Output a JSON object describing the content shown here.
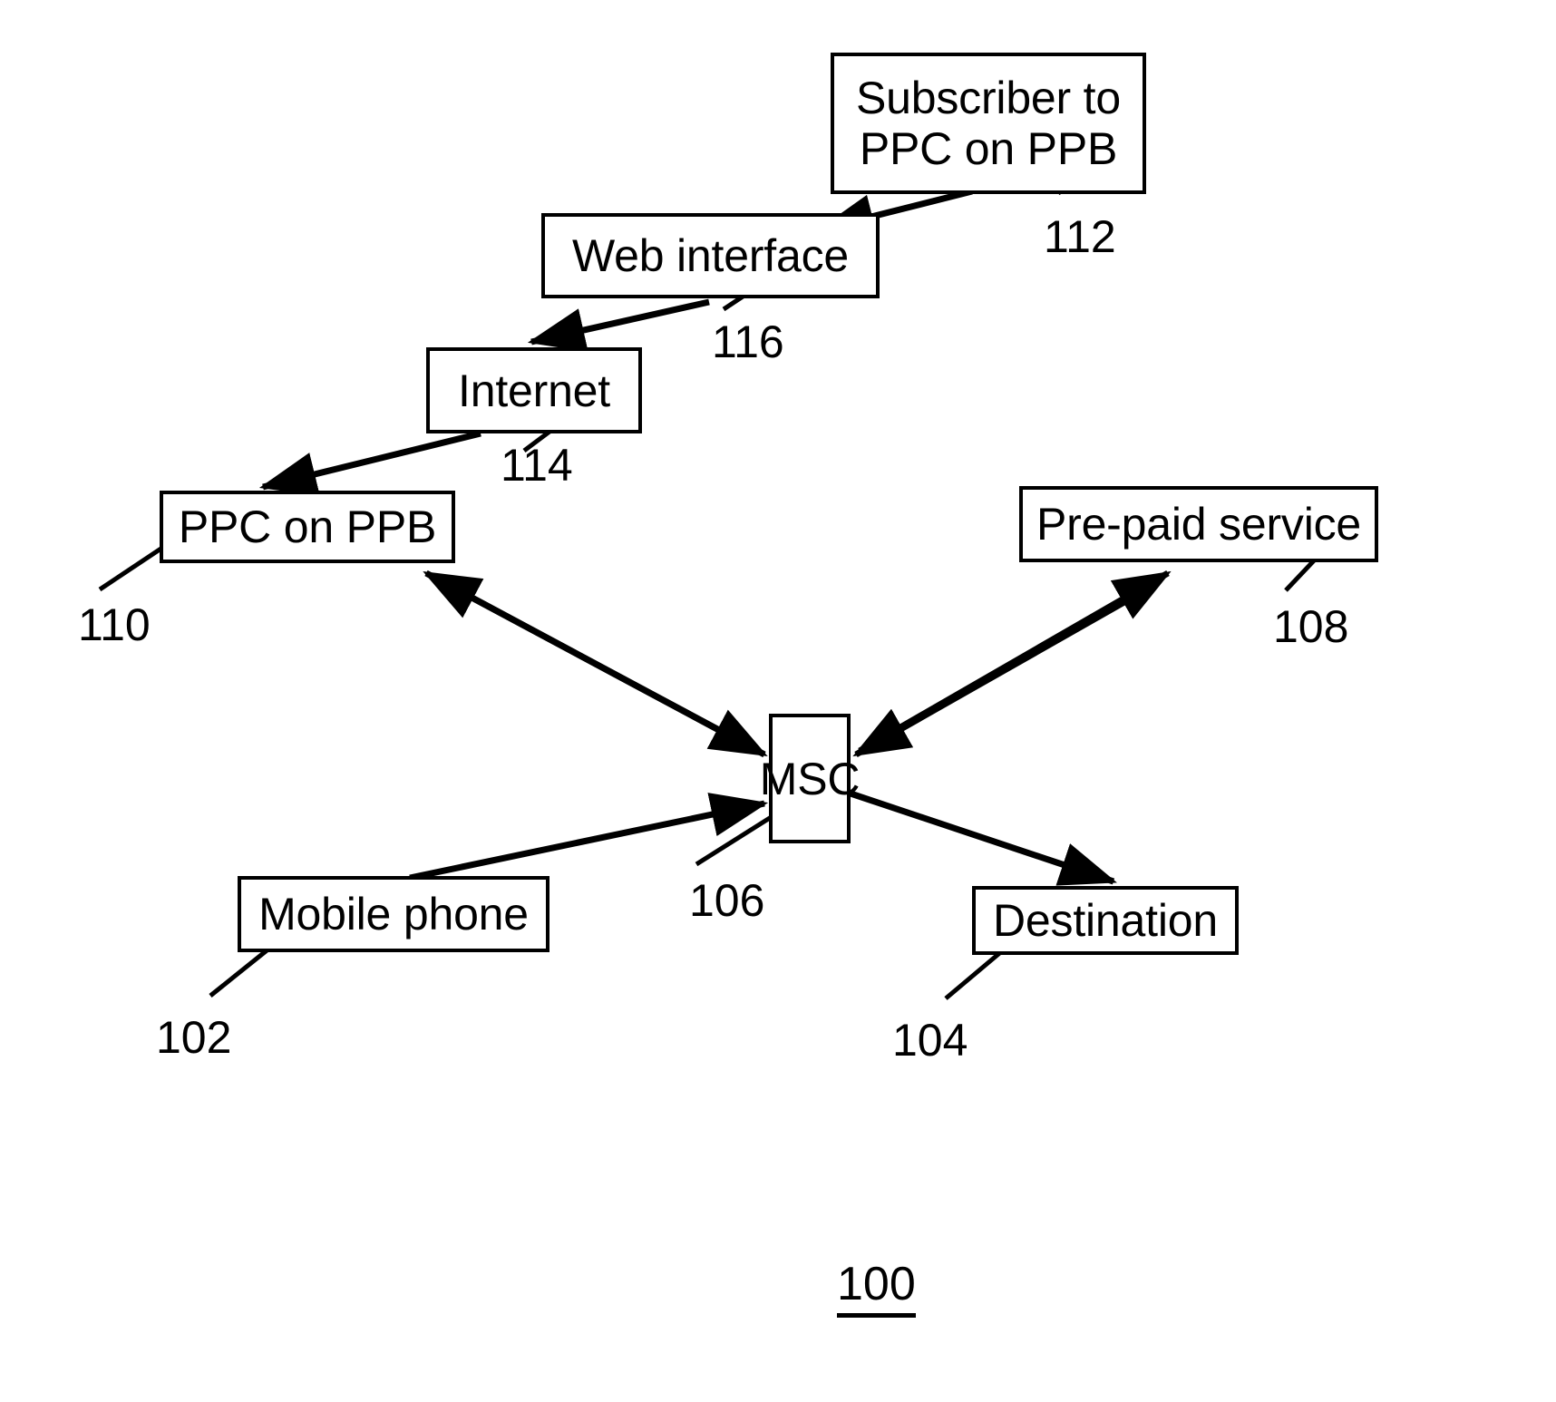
{
  "figure": {
    "number": "100",
    "type": "patent-block-diagram",
    "title": ""
  },
  "nodes": [
    {
      "id": "subscriber",
      "label": "Subscriber to\nPPC on PPB",
      "ref": "112"
    },
    {
      "id": "web",
      "label": "Web interface",
      "ref": "116"
    },
    {
      "id": "internet",
      "label": "Internet",
      "ref": "114"
    },
    {
      "id": "ppc",
      "label": "PPC on PPB",
      "ref": "110"
    },
    {
      "id": "prepaid",
      "label": "Pre-paid service",
      "ref": "108"
    },
    {
      "id": "msc",
      "label": "MSC",
      "ref": "106"
    },
    {
      "id": "mobile",
      "label": "Mobile phone",
      "ref": "102"
    },
    {
      "id": "dest",
      "label": "Destination",
      "ref": "104"
    }
  ],
  "edges": [
    {
      "from": "subscriber",
      "to": "web",
      "arrow": "single"
    },
    {
      "from": "web",
      "to": "internet",
      "arrow": "single"
    },
    {
      "from": "internet",
      "to": "ppc",
      "arrow": "single"
    },
    {
      "from": "msc",
      "to": "ppc",
      "arrow": "single"
    },
    {
      "from": "msc",
      "to": "prepaid",
      "arrow": "single"
    },
    {
      "from": "prepaid",
      "to": "msc",
      "arrow": "single"
    },
    {
      "from": "mobile",
      "to": "msc",
      "arrow": "single"
    },
    {
      "from": "msc",
      "to": "dest",
      "arrow": "single"
    }
  ],
  "colors": {
    "stroke": "#000000",
    "background": "#ffffff"
  }
}
